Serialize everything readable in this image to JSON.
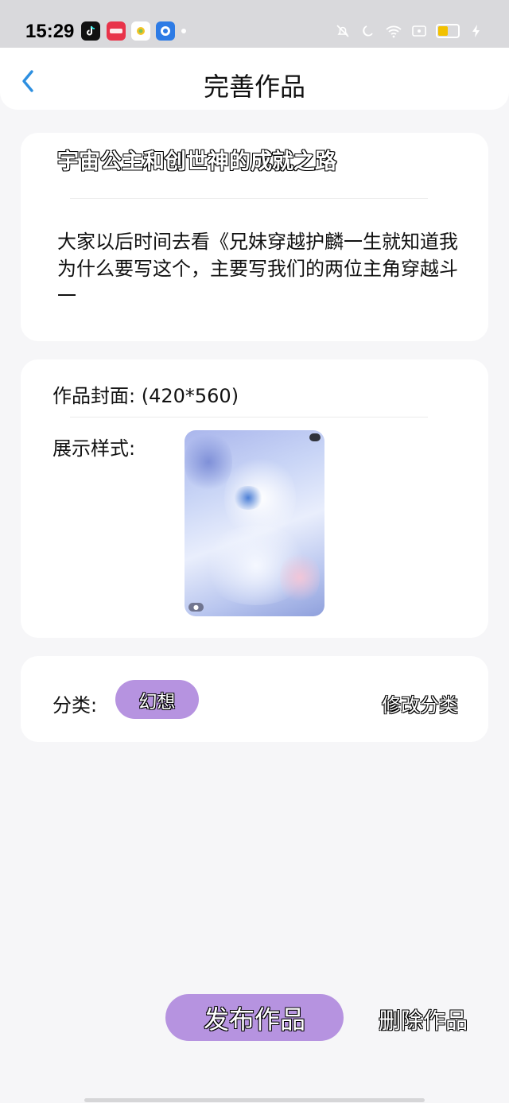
{
  "status_bar": {
    "time": "15:29",
    "apps": [
      {
        "name": "tiktok-icon",
        "color": "#111111",
        "glyph": "♪"
      },
      {
        "name": "xiaohongshu-icon",
        "color": "#e8334a",
        "glyph": "小红书"
      },
      {
        "name": "sun-app-icon",
        "color": "#f6d23a",
        "glyph": "☀"
      },
      {
        "name": "circle-app-icon",
        "color": "#2d7be5",
        "glyph": "●"
      }
    ],
    "icons": [
      "mute-bell-icon",
      "moon-icon",
      "wifi-icon",
      "nfc-icon",
      "battery-icon",
      "charging-icon"
    ]
  },
  "nav": {
    "title": "完善作品",
    "back_icon": "chevron-left-icon"
  },
  "work": {
    "title": "宇宙公主和创世神的成就之路",
    "description": "大家以后时间去看《兄妹穿越护麟一生就知道我为什么要写这个，主要写我们的两位主角穿越斗一"
  },
  "cover": {
    "label": "作品封面: (420*560)",
    "display_label": "展示样式:"
  },
  "category": {
    "label": "分类:",
    "value": "幻想",
    "edit_label": "修改分类"
  },
  "actions": {
    "publish_label": "发布作品",
    "delete_label": "删除作品"
  },
  "colors": {
    "accent": "#b693e0",
    "back_arrow": "#2d8fe0",
    "background": "#f6f6f8"
  }
}
